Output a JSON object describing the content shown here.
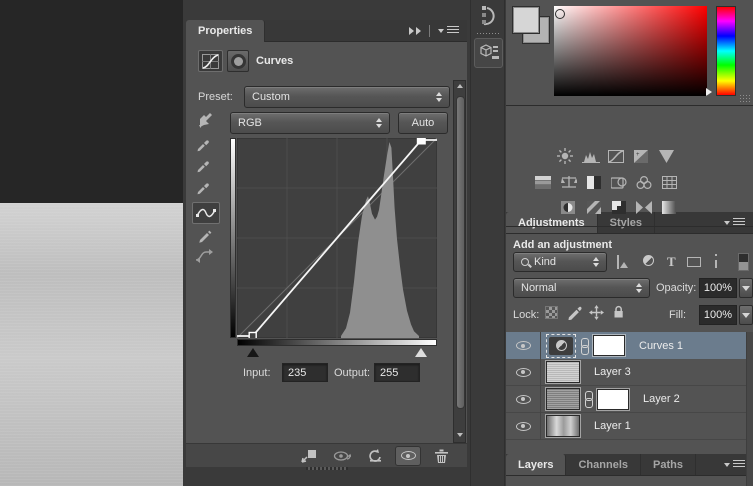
{
  "properties_panel": {
    "tab": "Properties",
    "panel_title": "Curves",
    "preset_label": "Preset:",
    "preset_value": "Custom",
    "channel_value": "RGB",
    "auto_label": "Auto",
    "input_label": "Input:",
    "input_value": "235",
    "output_label": "Output:",
    "output_value": "255",
    "left_tools": [
      "targeted-adjustment-tool",
      "black-point-eyedropper",
      "gray-point-eyedropper",
      "white-point-eyedropper",
      "edit-points-tool",
      "pencil-tool",
      "smooth-curve"
    ],
    "bottom_toolbar": [
      "clip-to-layer",
      "toggle-previous-state",
      "reset",
      "toggle-visibility",
      "delete"
    ],
    "curves_graph": {
      "type": "area",
      "grid_divisions": 4,
      "selected_point": {
        "input": 235,
        "output": 255
      },
      "curve": {
        "black_point": {
          "input": 20,
          "output": 0
        },
        "white_point": {
          "input": 235,
          "output": 255
        }
      },
      "histogram": [
        [
          0.52,
          0
        ],
        [
          0.545,
          0.04
        ],
        [
          0.565,
          0.12
        ],
        [
          0.585,
          0.28
        ],
        [
          0.605,
          0.48
        ],
        [
          0.625,
          0.62
        ],
        [
          0.645,
          0.7
        ],
        [
          0.655,
          0.72
        ],
        [
          0.665,
          0.68
        ],
        [
          0.675,
          0.63
        ],
        [
          0.69,
          0.6
        ],
        [
          0.7,
          0.615
        ],
        [
          0.71,
          0.65
        ],
        [
          0.72,
          0.72
        ],
        [
          0.735,
          0.83
        ],
        [
          0.75,
          0.93
        ],
        [
          0.762,
          1.0
        ],
        [
          0.772,
          0.97
        ],
        [
          0.78,
          0.82
        ],
        [
          0.788,
          0.66
        ],
        [
          0.8,
          0.5
        ],
        [
          0.815,
          0.36
        ],
        [
          0.83,
          0.24
        ],
        [
          0.85,
          0.13
        ],
        [
          0.87,
          0.06
        ],
        [
          0.885,
          0.025
        ],
        [
          0.91,
          0
        ]
      ]
    }
  },
  "color_panel": {
    "foreground_color": "#d6d6d6",
    "background_color": "#b3b3b3",
    "gradient_hue": "#ff0000",
    "hue_strip": [
      "#ff0000",
      "#ff00ff",
      "#0000ff",
      "#00ffff",
      "#00ff00",
      "#ffff00",
      "#ff0000"
    ]
  },
  "adjustments_panel": {
    "tabs": [
      {
        "label": "Adjustments",
        "active": true
      },
      {
        "label": "Styles",
        "active": false
      }
    ],
    "header": "Add an adjustment",
    "icons_row1": [
      "brightness-contrast",
      "levels",
      "curves",
      "exposure",
      "vibrance"
    ],
    "icons_row2": [
      "hue-saturation",
      "color-balance",
      "black-white",
      "photo-filter",
      "channel-mixer",
      "color-lookup"
    ],
    "icons_row3": [
      "invert",
      "posterize",
      "threshold",
      "gradient-map",
      "selective-color"
    ]
  },
  "layers_panel": {
    "tabs": [
      {
        "label": "Layers",
        "active": true
      },
      {
        "label": "Channels",
        "active": false
      },
      {
        "label": "Paths",
        "active": false
      }
    ],
    "filter_label": "Kind",
    "filter_icons": [
      "pixel-layers",
      "adjustment-layers",
      "type-layers",
      "shape-layers",
      "smart-objects"
    ],
    "blend_mode": "Normal",
    "opacity_label": "Opacity:",
    "opacity_value": "100%",
    "lock_label": "Lock:",
    "lock_icons": [
      "lock-transparency",
      "lock-pixels",
      "lock-position",
      "lock-all"
    ],
    "fill_label": "Fill:",
    "fill_value": "100%",
    "layers": [
      {
        "name": "Curves 1",
        "type": "adjustment",
        "selected": true,
        "visible": true,
        "linked_mask": true
      },
      {
        "name": "Layer 3",
        "type": "pixel",
        "selected": false,
        "visible": true,
        "linked_mask": false
      },
      {
        "name": "Layer 2",
        "type": "pixel",
        "selected": false,
        "visible": true,
        "linked_mask": true
      },
      {
        "name": "Layer 1",
        "type": "pixel",
        "selected": false,
        "visible": true,
        "linked_mask": false
      }
    ]
  },
  "dock_icons": [
    "history-panel",
    "3d-panel"
  ],
  "colors": {
    "app_bg": "#3a3a3a",
    "panel_bg": "#535353",
    "tab_bar_bg": "#383838",
    "canvas_dark": "#262626",
    "graph_bg": "#404040",
    "histogram_fill": "#8f8f8f",
    "curve_line": "#f5f5f5",
    "selected_layer_bg": "#6b7c8d",
    "field_bg": "#2e2e2e"
  }
}
